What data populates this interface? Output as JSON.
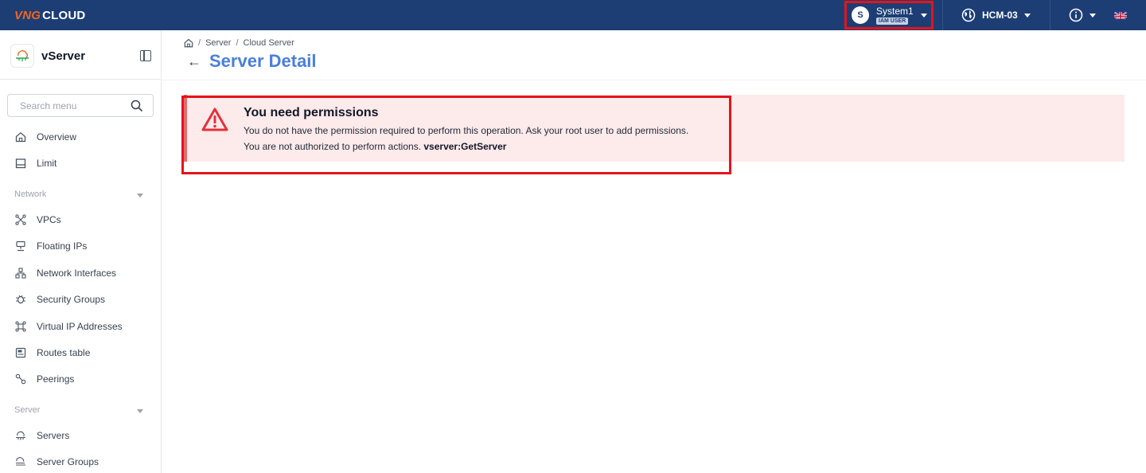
{
  "topbar": {
    "logo_part1": "VNG",
    "logo_part2": "CLOUD",
    "user": {
      "avatar_initial": "S",
      "name": "System1",
      "badge": "IAM USER"
    },
    "region": "HCM-03"
  },
  "sidebar": {
    "app_title": "vServer",
    "search_placeholder": "Search menu",
    "top_items": [
      {
        "label": "Overview",
        "icon": "home-icon"
      },
      {
        "label": "Limit",
        "icon": "limit-icon"
      }
    ],
    "sections": [
      {
        "label": "Network",
        "items": [
          {
            "label": "VPCs",
            "icon": "vpc-icon"
          },
          {
            "label": "Floating IPs",
            "icon": "floating-ip-icon"
          },
          {
            "label": "Network Interfaces",
            "icon": "network-interface-icon"
          },
          {
            "label": "Security Groups",
            "icon": "security-group-icon"
          },
          {
            "label": "Virtual IP Addresses",
            "icon": "virtual-ip-icon"
          },
          {
            "label": "Routes table",
            "icon": "routes-table-icon"
          },
          {
            "label": "Peerings",
            "icon": "peering-icon"
          }
        ]
      },
      {
        "label": "Server",
        "items": [
          {
            "label": "Servers",
            "icon": "server-icon"
          },
          {
            "label": "Server Groups",
            "icon": "server-group-icon"
          }
        ]
      }
    ]
  },
  "main": {
    "breadcrumb": [
      "Server",
      "Cloud Server"
    ],
    "title": "Server Detail",
    "alert": {
      "title": "You need permissions",
      "line1": "You do not have the permission required to perform this operation. Ask your root user to add permissions.",
      "line2_prefix": "You are not authorized to perform actions.",
      "line2_action": "vserver:GetServer"
    }
  },
  "colors": {
    "topbar": "#1d3e74",
    "accent": "#4a7fd9",
    "alert_bg": "#fdeaea",
    "alert_icon": "#e3313b",
    "highlight": "#e3141b"
  }
}
